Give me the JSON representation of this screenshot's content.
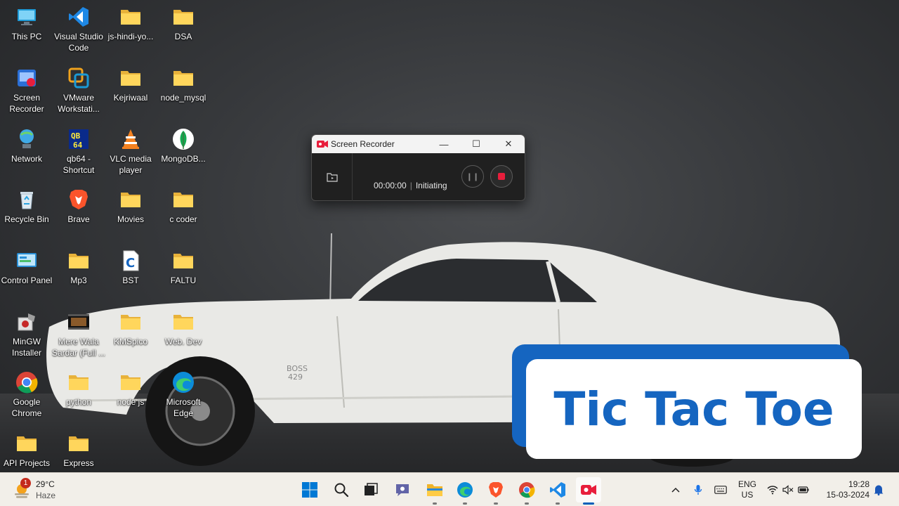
{
  "desktop": {
    "icons": [
      {
        "label": "This PC",
        "icon": "this-pc-icon"
      },
      {
        "label": "Visual Studio Code",
        "icon": "vscode-icon"
      },
      {
        "label": "js-hindi-yo...",
        "icon": "folder-icon"
      },
      {
        "label": "DSA",
        "icon": "folder-icon"
      },
      {
        "label": "Screen Recorder",
        "icon": "screen-recorder-icon"
      },
      {
        "label": "VMware Workstati...",
        "icon": "vmware-icon"
      },
      {
        "label": "Kejriwaal",
        "icon": "folder-icon"
      },
      {
        "label": "node_mysql",
        "icon": "folder-icon"
      },
      {
        "label": "Network",
        "icon": "network-icon"
      },
      {
        "label": "qb64 - Shortcut",
        "icon": "qb64-icon"
      },
      {
        "label": "VLC media player",
        "icon": "vlc-icon"
      },
      {
        "label": "MongoDB...",
        "icon": "mongodb-icon"
      },
      {
        "label": "Recycle Bin",
        "icon": "recycle-bin-icon"
      },
      {
        "label": "Brave",
        "icon": "brave-icon"
      },
      {
        "label": "Movies",
        "icon": "folder-icon"
      },
      {
        "label": "c coder",
        "icon": "folder-icon"
      },
      {
        "label": "Control Panel",
        "icon": "control-panel-icon"
      },
      {
        "label": "Mp3",
        "icon": "folder-icon"
      },
      {
        "label": "BST",
        "icon": "c-file-icon"
      },
      {
        "label": "FALTU",
        "icon": "folder-icon"
      },
      {
        "label": "MinGW Installer",
        "icon": "mingw-icon"
      },
      {
        "label": "Mere Wala Sardar (Full ...",
        "icon": "video-file-icon"
      },
      {
        "label": "KMSpico",
        "icon": "folder-icon"
      },
      {
        "label": "Web. Dev",
        "icon": "folder-icon"
      },
      {
        "label": "Google Chrome",
        "icon": "chrome-icon"
      },
      {
        "label": "python",
        "icon": "folder-icon"
      },
      {
        "label": "node js",
        "icon": "folder-icon"
      },
      {
        "label": "Microsoft Edge",
        "icon": "edge-icon"
      },
      {
        "label": "API Projects",
        "icon": "folder-icon"
      },
      {
        "label": "Express",
        "icon": "folder-icon"
      }
    ]
  },
  "recorder": {
    "title": "Screen Recorder",
    "minimize": "—",
    "maximize": "☐",
    "close": "✕",
    "time": "00:00:00",
    "separator": "|",
    "state": "Initiating"
  },
  "overlay": {
    "text": "Tic Tac Toe",
    "color": "#1565c0"
  },
  "taskbar": {
    "weather_badge": "1",
    "temperature": "29°C",
    "condition": "Haze",
    "apps": [
      {
        "name": "start-button",
        "icon": "windows-logo-icon"
      },
      {
        "name": "search-button",
        "icon": "search-icon"
      },
      {
        "name": "task-view-button",
        "icon": "task-view-icon"
      },
      {
        "name": "teams-chat-button",
        "icon": "chat-icon"
      },
      {
        "name": "file-explorer-button",
        "icon": "folder-icon"
      },
      {
        "name": "edge-button",
        "icon": "edge-icon"
      },
      {
        "name": "brave-button",
        "icon": "brave-icon"
      },
      {
        "name": "chrome-button",
        "icon": "chrome-icon"
      },
      {
        "name": "vscode-button",
        "icon": "vscode-icon"
      },
      {
        "name": "screen-recorder-button",
        "icon": "screen-recorder-icon"
      }
    ],
    "lang_line1": "ENG",
    "lang_line2": "US",
    "time": "19:28",
    "date": "15-03-2024"
  }
}
